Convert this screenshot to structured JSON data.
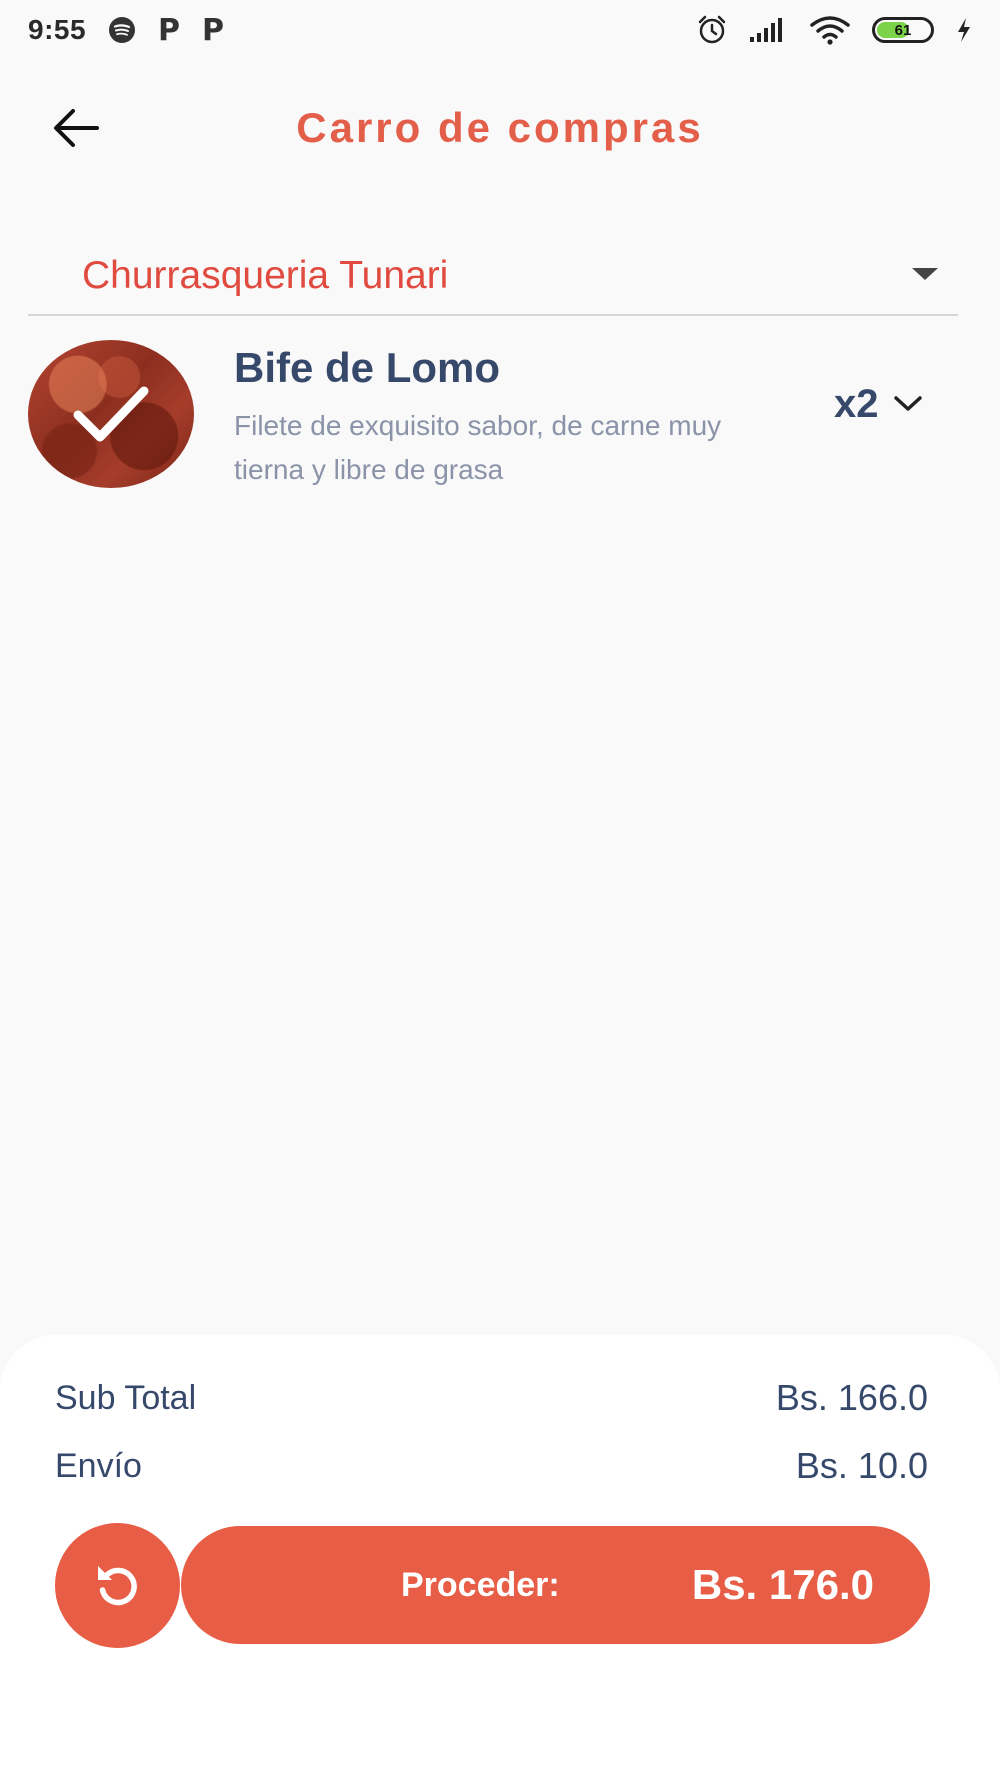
{
  "status_bar": {
    "time": "9:55",
    "left_icons": [
      "spotify-icon",
      "p-icon",
      "p-icon"
    ],
    "p_glyph": "P",
    "right_icons": [
      "alarm-icon",
      "signal-icon",
      "wifi-icon",
      "battery-icon",
      "charging-icon"
    ],
    "battery_level": "61",
    "battery_fraction": 0.61
  },
  "header": {
    "title": "Carro de compras",
    "back_icon": "arrow-left-icon"
  },
  "restaurant_select": {
    "selected": "Churrasqueria Tunari"
  },
  "cart": {
    "items": [
      {
        "name": "Bife de Lomo",
        "description": "Filete de exquisito sabor, de carne muy tierna y libre de grasa",
        "quantity": "x2",
        "selected": true
      }
    ]
  },
  "summary": {
    "subtotal_label": "Sub Total",
    "subtotal_value": "Bs. 166.0",
    "shipping_label": "Envío",
    "shipping_value": "Bs. 10.0",
    "proceed_label": "Proceder:",
    "proceed_total": "Bs. 176.0",
    "reset_icon": "reset-icon"
  },
  "colors": {
    "accent": "#e85d45",
    "title": "#e35f4a",
    "text_dark": "#36496b",
    "text_muted": "#8a93a8",
    "background": "#f9f9f9"
  }
}
